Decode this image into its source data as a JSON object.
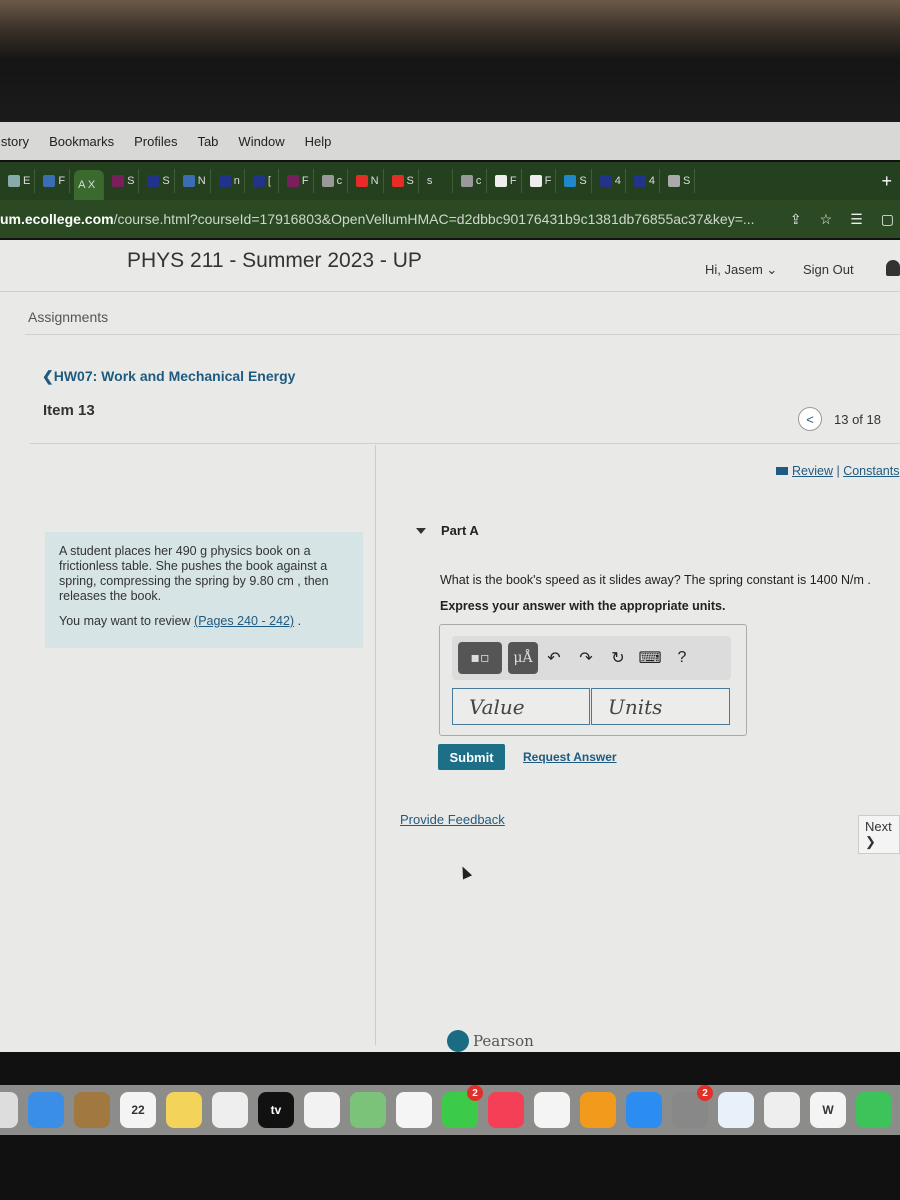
{
  "menubar": {
    "items": [
      "istory",
      "Bookmarks",
      "Profiles",
      "Tab",
      "Window",
      "Help"
    ]
  },
  "tabs": [
    {
      "label": "E",
      "color": "#8aa"
    },
    {
      "label": "F",
      "color": "#3b6db5"
    },
    {
      "label": "A X",
      "color": "",
      "active": true
    },
    {
      "label": "S",
      "color": "#7a1f5c"
    },
    {
      "label": "S",
      "color": "#22338a"
    },
    {
      "label": "N",
      "color": "#3b6db5"
    },
    {
      "label": "n",
      "color": "#22338a"
    },
    {
      "label": "[",
      "color": "#22338a"
    },
    {
      "label": "F",
      "color": "#7a1f5c"
    },
    {
      "label": "c",
      "color": "#999"
    },
    {
      "label": "N",
      "color": "#e52d27"
    },
    {
      "label": "S",
      "color": "#e52d27"
    },
    {
      "label": "s",
      "color": ""
    },
    {
      "label": "c",
      "color": "#999"
    },
    {
      "label": "F",
      "color": "#eee"
    },
    {
      "label": "F",
      "color": "#eee"
    },
    {
      "label": "S",
      "color": "#1e88c9"
    },
    {
      "label": "4",
      "color": "#22338a"
    },
    {
      "label": "4",
      "color": "#22338a"
    },
    {
      "label": "S",
      "color": "#aaa"
    }
  ],
  "new_tab": "+",
  "url": {
    "domain": "um.ecollege.com",
    "path": "/course.html?courseId=17916803&OpenVellumHMAC=d2dbbc90176431b9c1381db76855ac37&key=..."
  },
  "url_icons": [
    "share-icon",
    "bookmark-star-icon",
    "reading-list-icon",
    "sidebar-icon"
  ],
  "header": {
    "course_title": "PHYS 211 - Summer 2023 - UP",
    "greeting": "Hi, Jasem ⌄",
    "sign_out": "Sign Out"
  },
  "breadcrumb": {
    "assignments": "Assignments",
    "back": "❮HW07: Work and Mechanical Energy",
    "item": "Item 13"
  },
  "pager": {
    "prev": "<",
    "position": "13 of 18"
  },
  "resources": {
    "review": "Review",
    "sep": " | ",
    "constants": "Constants"
  },
  "problem": {
    "text": "A student places her 490 g physics book on a frictionless table. She pushes the book against a spring, compressing the spring by 9.80 cm , then releases the book.",
    "review_prefix": "You may want to review ",
    "review_link": "(Pages 240 - 242)",
    "review_suffix": " ."
  },
  "part": {
    "label": "Part A",
    "question": "What is the book's speed as it slides away? The spring constant is 1400 N/m .",
    "instruction": "Express your answer with the appropriate units.",
    "toolbar": {
      "templates": "▪▫",
      "units": "μÅ",
      "undo": "↶",
      "redo": "↷",
      "reset": "↻",
      "keyboard": "⌨",
      "help": "?"
    },
    "value_placeholder": "Value",
    "units_placeholder": "Units",
    "submit": "Submit",
    "request_answer": "Request Answer"
  },
  "feedback": "Provide Feedback",
  "next": "Next ❯",
  "footer_logo": "Pearson",
  "dock": [
    {
      "name": "launchpad",
      "color": "#ddd"
    },
    {
      "name": "mail",
      "color": "#3a8ee6"
    },
    {
      "name": "contacts",
      "color": "#a07840"
    },
    {
      "name": "calendar",
      "color": "#f4f4f4",
      "text": "22"
    },
    {
      "name": "notes",
      "color": "#f3d35a"
    },
    {
      "name": "freeform",
      "color": "#eee"
    },
    {
      "name": "apple-tv",
      "color": "#111",
      "text": "tv"
    },
    {
      "name": "reminders",
      "color": "#f2f2f2"
    },
    {
      "name": "maps",
      "color": "#7cc37a"
    },
    {
      "name": "photos",
      "color": "#f5f5f5"
    },
    {
      "name": "facetime",
      "color": "#3ccb48",
      "badge": "2"
    },
    {
      "name": "music",
      "color": "#f43f56"
    },
    {
      "name": "news",
      "color": "#f4f4f4"
    },
    {
      "name": "books",
      "color": "#f29a1c"
    },
    {
      "name": "app-store",
      "color": "#2b8df2"
    },
    {
      "name": "system-settings",
      "color": "#888",
      "badge": "2"
    },
    {
      "name": "safari",
      "color": "#e8f0fa"
    },
    {
      "name": "chrome",
      "color": "#eee"
    },
    {
      "name": "word",
      "color": "#f4f4f4",
      "text": "W"
    },
    {
      "name": "whatsapp",
      "color": "#3cc35a"
    }
  ],
  "colors": {
    "accent": "#1c6f86",
    "link": "#1f5a80",
    "browser_chrome": "#2b4a23",
    "problem_bg": "#d6e4e5"
  }
}
